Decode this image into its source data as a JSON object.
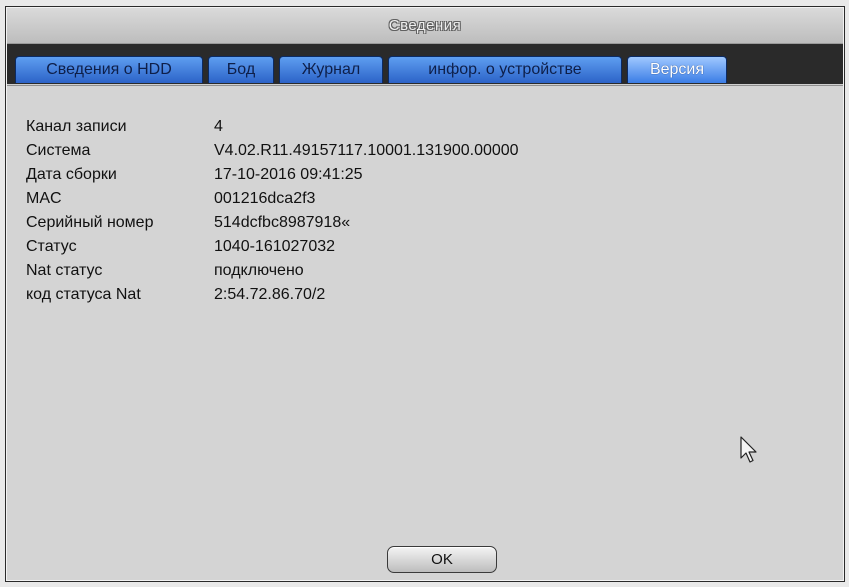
{
  "window": {
    "title": "Сведения"
  },
  "tabs": [
    {
      "label": "Сведения о HDD",
      "active": false
    },
    {
      "label": "Бод",
      "active": false
    },
    {
      "label": "Журнал",
      "active": false
    },
    {
      "label": "инфор. о устройстве",
      "active": false
    },
    {
      "label": "Версия",
      "active": true
    }
  ],
  "info": [
    {
      "label": "Канал записи",
      "value": "4"
    },
    {
      "label": "Система",
      "value": "V4.02.R11.49157117.10001.131900.00000"
    },
    {
      "label": "Дата сборки",
      "value": "17-10-2016 09:41:25"
    },
    {
      "label": "MAC",
      "value": "001216dca2f3"
    },
    {
      "label": "Серийный номер",
      "value": "514dcfbc8987918«"
    },
    {
      "label": "Статус",
      "value": "1040-161027032"
    },
    {
      "label": "Nat статус",
      "value": "подключено"
    },
    {
      "label": "код статуса Nat",
      "value": "2:54.72.86.70/2"
    }
  ],
  "buttons": {
    "ok_label": "OK"
  },
  "icons": {
    "cursor": "mouse-pointer-icon"
  },
  "colors": {
    "tab_inactive": "#2c63c8",
    "tab_active": "#9fc8ff",
    "tabbar_background": "#2a2a2a",
    "panel_background": "#d4d4d4"
  }
}
